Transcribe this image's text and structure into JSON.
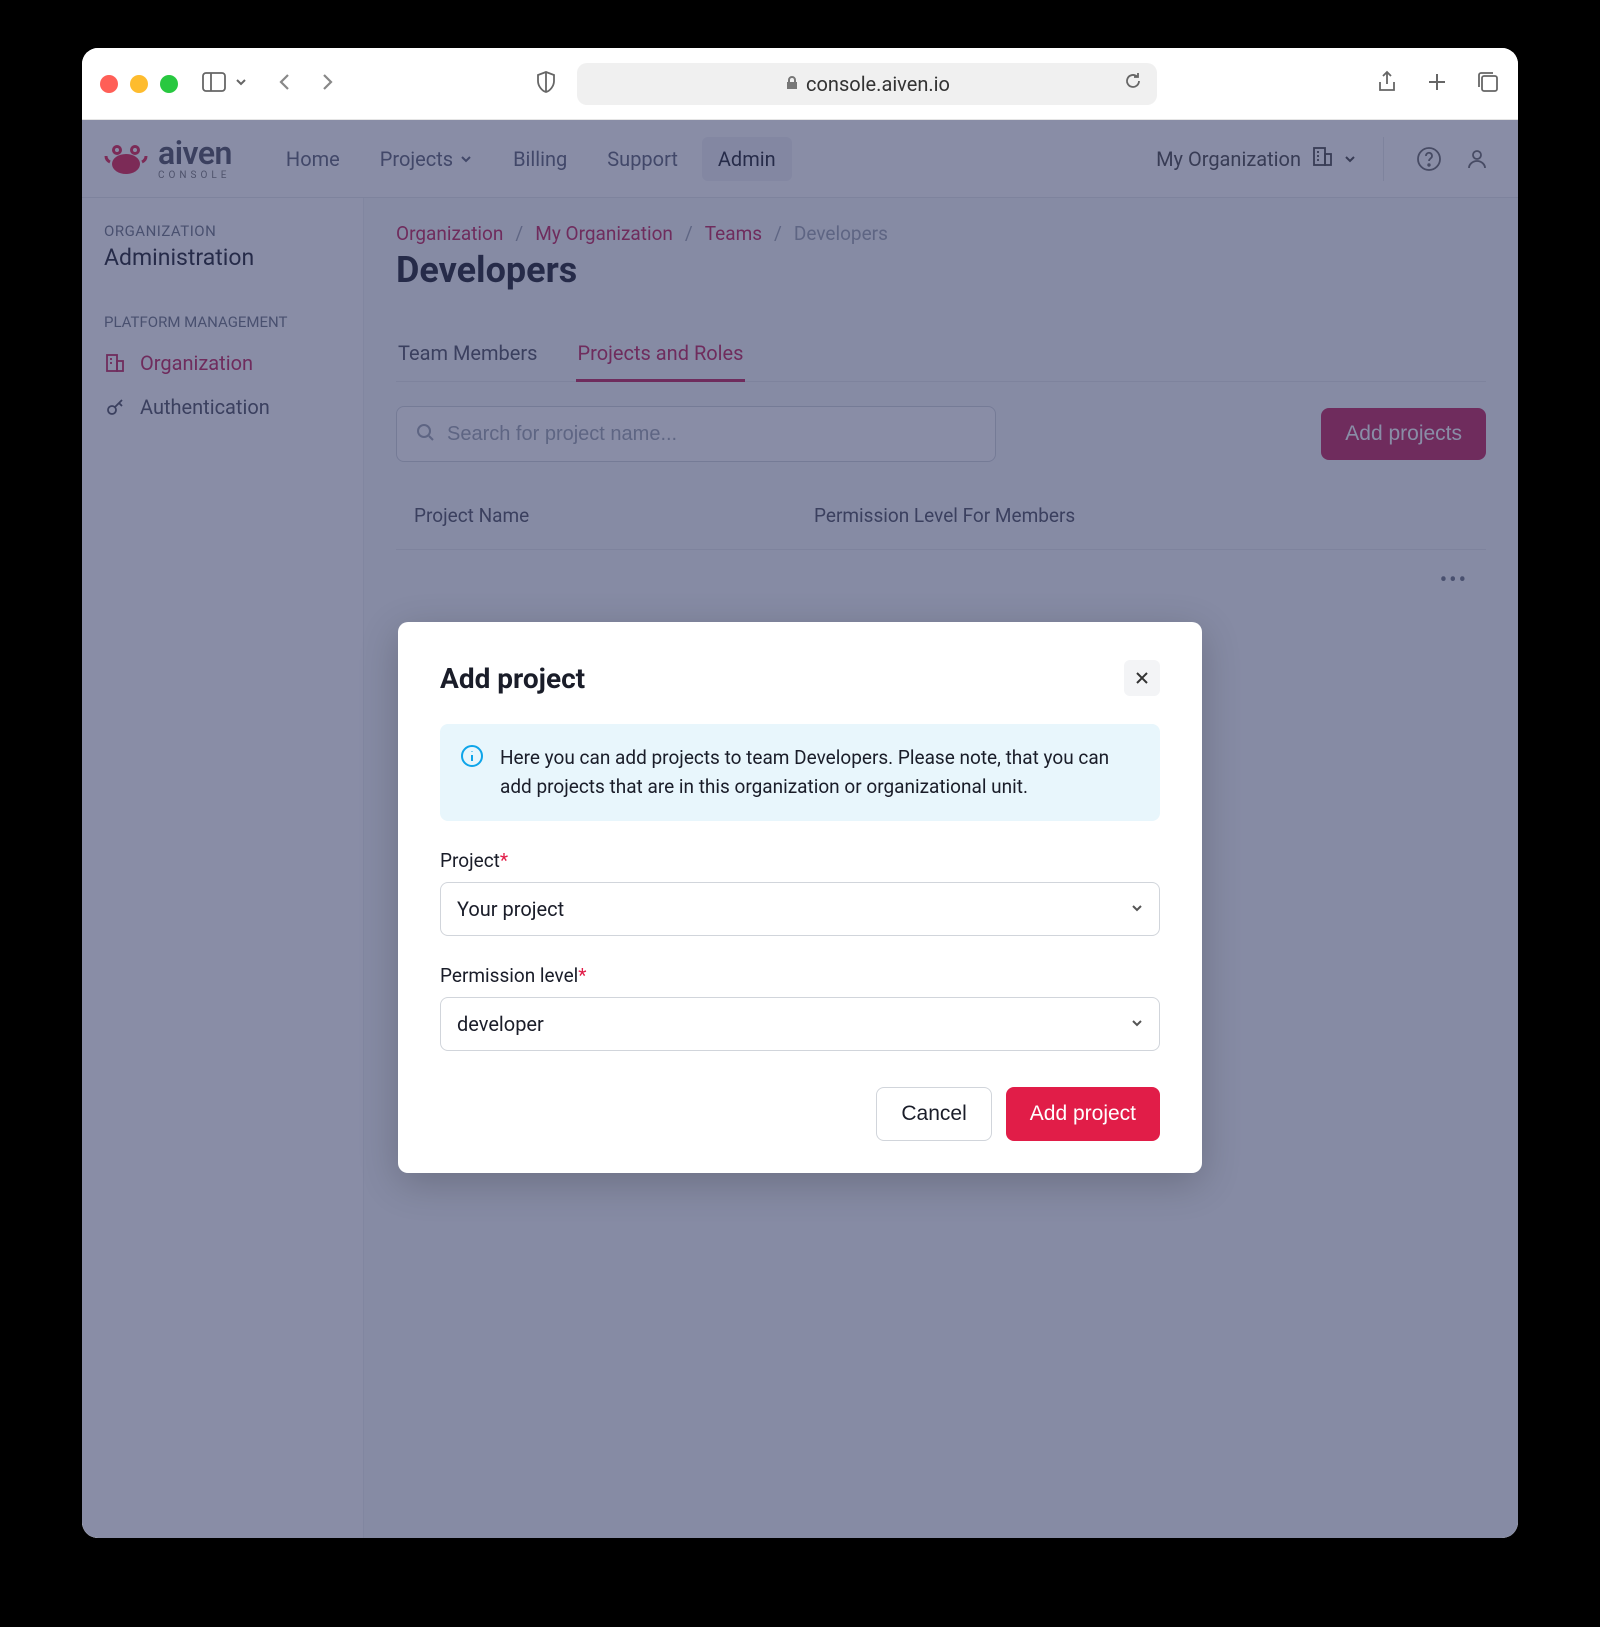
{
  "browser": {
    "url": "console.aiven.io"
  },
  "logo": {
    "main": "aiven",
    "sub": "CONSOLE"
  },
  "nav": {
    "home": "Home",
    "projects": "Projects",
    "billing": "Billing",
    "support": "Support",
    "admin": "Admin"
  },
  "org_picker": "My Organization",
  "sidebar": {
    "eyebrow": "ORGANIZATION",
    "title": "Administration",
    "section": "PLATFORM MANAGEMENT",
    "organization": "Organization",
    "authentication": "Authentication"
  },
  "crumbs": {
    "organization": "Organization",
    "my_org": "My Organization",
    "teams": "Teams",
    "developers": "Developers"
  },
  "page_title": "Developers",
  "tabs": {
    "members": "Team Members",
    "projects": "Projects and Roles"
  },
  "search_placeholder": "Search for project name...",
  "add_projects_btn": "Add projects",
  "table": {
    "col1": "Project Name",
    "col2": "Permission Level For Members"
  },
  "modal": {
    "title": "Add project",
    "info": "Here you can add projects to team Developers. Please note, that you can add projects that are in this organization or organizational unit.",
    "project_label": "Project",
    "project_value": "Your project",
    "permission_label": "Permission level",
    "permission_value": "developer",
    "cancel": "Cancel",
    "submit": "Add project"
  }
}
